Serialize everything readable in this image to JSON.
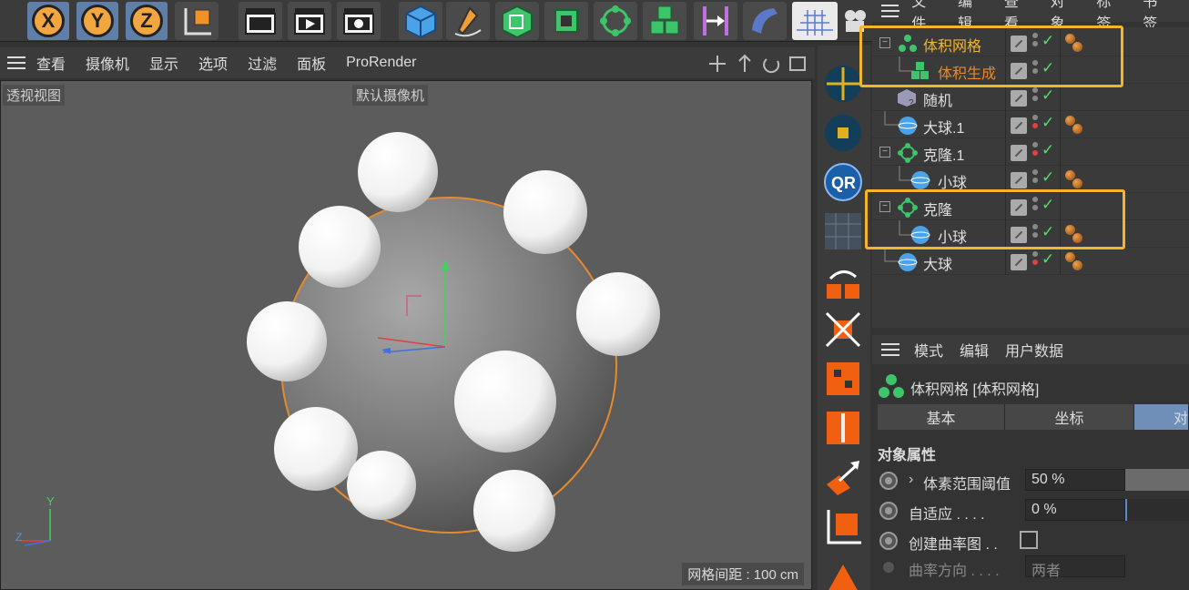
{
  "toolbar": {
    "axis_x": "X",
    "axis_y": "Y",
    "axis_z": "Z"
  },
  "viewport": {
    "menu": [
      "查看",
      "摄像机",
      "显示",
      "选项",
      "过滤",
      "面板",
      "ProRender"
    ],
    "view_label": "透视视图",
    "camera_label": "默认摄像机",
    "grid_info": "网格间距 : 100 cm",
    "axis_y_label": "Y",
    "axis_z_label": "Z"
  },
  "object_manager": {
    "menu": [
      "文件",
      "编辑",
      "查看",
      "对象",
      "标签",
      "书签"
    ],
    "objects": [
      {
        "name": "体积网格",
        "highlight": true
      },
      {
        "name": "体积生成",
        "highlight": true
      },
      {
        "name": "随机"
      },
      {
        "name": "大球.1"
      },
      {
        "name": "克隆.1"
      },
      {
        "name": "小球"
      },
      {
        "name": "克隆"
      },
      {
        "name": "小球"
      },
      {
        "name": "大球"
      }
    ]
  },
  "attribute_manager": {
    "menu": [
      "模式",
      "编辑",
      "用户数据"
    ],
    "title": "体积网格 [体积网格]",
    "tabs": [
      "基本",
      "坐标",
      "对"
    ],
    "section": "对象属性",
    "props": {
      "threshold_label": "体素范围阈值",
      "threshold_value": "50 %",
      "adaptive_label": "自适应 . . . .",
      "adaptive_value": "0 %",
      "curvature_label": "创建曲率图 . .",
      "direction_label": "曲率方向 . . . .",
      "direction_value": "两者"
    }
  },
  "colors": {
    "highlight_border": "#f5b52a",
    "active_object": "#f5b52a",
    "child_active": "#e58a2e",
    "check": "#4fe06b"
  }
}
